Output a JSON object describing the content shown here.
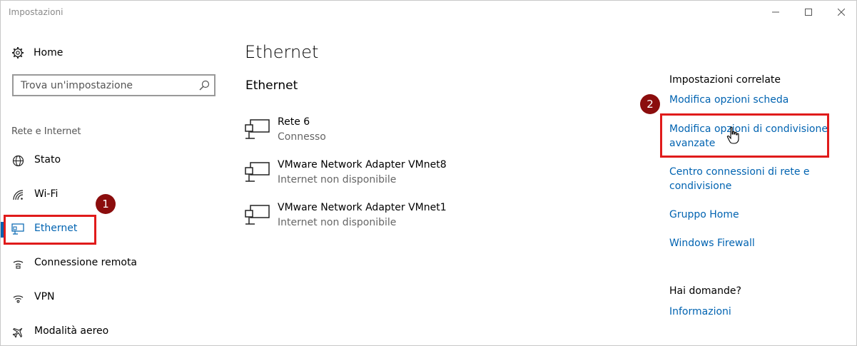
{
  "window": {
    "title": "Impostazioni"
  },
  "sidebar": {
    "home_label": "Home",
    "search_placeholder": "Trova un'impostazione",
    "section_title": "Rete e Internet",
    "items": [
      {
        "label": "Stato",
        "icon": "globe-icon"
      },
      {
        "label": "Wi-Fi",
        "icon": "wifi-icon"
      },
      {
        "label": "Ethernet",
        "icon": "ethernet-icon",
        "active": true
      },
      {
        "label": "Connessione remota",
        "icon": "dialup-icon"
      },
      {
        "label": "VPN",
        "icon": "vpn-icon"
      },
      {
        "label": "Modalità aereo",
        "icon": "airplane-icon"
      }
    ]
  },
  "main": {
    "title": "Ethernet",
    "subtitle": "Ethernet",
    "adapters": [
      {
        "name": "Rete  6",
        "status": "Connesso"
      },
      {
        "name": "VMware Network Adapter VMnet8",
        "status": "Internet non disponibile"
      },
      {
        "name": "VMware Network Adapter VMnet1",
        "status": "Internet non disponibile"
      }
    ]
  },
  "related": {
    "title": "Impostazioni correlate",
    "links": [
      "Modifica opzioni scheda",
      "Modifica opzioni di condivisione avanzate",
      "Centro connessioni di rete e condivisione",
      "Gruppo Home",
      "Windows Firewall"
    ]
  },
  "questions": {
    "title": "Hai domande?",
    "link": "Informazioni"
  },
  "annotations": {
    "badge1": "1",
    "badge2": "2"
  },
  "colors": {
    "accent": "#0063b1",
    "highlight": "#e01b1b",
    "badge": "#8b0d0d"
  }
}
